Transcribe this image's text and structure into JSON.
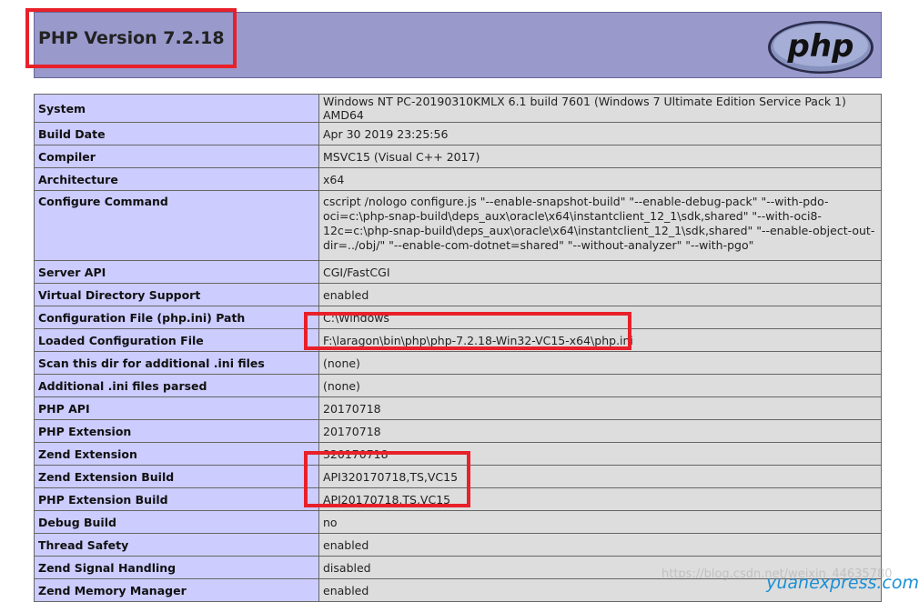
{
  "header": {
    "title": "PHP Version 7.2.18",
    "logo_text": "php"
  },
  "rows": [
    {
      "key": "System",
      "value": "Windows NT PC-20190310KMLX 6.1 build 7601 (Windows 7 Ultimate Edition Service Pack 1) AMD64"
    },
    {
      "key": "Build Date",
      "value": "Apr 30 2019 23:25:56"
    },
    {
      "key": "Compiler",
      "value": "MSVC15 (Visual C++ 2017)"
    },
    {
      "key": "Architecture",
      "value": "x64"
    },
    {
      "key": "Configure Command",
      "value": "cscript /nologo configure.js \"--enable-snapshot-build\" \"--enable-debug-pack\" \"--with-pdo-oci=c:\\php-snap-build\\deps_aux\\oracle\\x64\\instantclient_12_1\\sdk,shared\" \"--with-oci8-12c=c:\\php-snap-build\\deps_aux\\oracle\\x64\\instantclient_12_1\\sdk,shared\" \"--enable-object-out-dir=../obj/\" \"--enable-com-dotnet=shared\" \"--without-analyzer\" \"--with-pgo\""
    },
    {
      "key": "Server API",
      "value": "CGI/FastCGI"
    },
    {
      "key": "Virtual Directory Support",
      "value": "enabled"
    },
    {
      "key": "Configuration File (php.ini) Path",
      "value": "C:\\Windows"
    },
    {
      "key": "Loaded Configuration File",
      "value": "F:\\laragon\\bin\\php\\php-7.2.18-Win32-VC15-x64\\php.ini"
    },
    {
      "key": "Scan this dir for additional .ini files",
      "value": "(none)"
    },
    {
      "key": "Additional .ini files parsed",
      "value": "(none)"
    },
    {
      "key": "PHP API",
      "value": "20170718"
    },
    {
      "key": "PHP Extension",
      "value": "20170718"
    },
    {
      "key": "Zend Extension",
      "value": "320170718"
    },
    {
      "key": "Zend Extension Build",
      "value": "API320170718,TS,VC15"
    },
    {
      "key": "PHP Extension Build",
      "value": "API20170718,TS,VC15"
    },
    {
      "key": "Debug Build",
      "value": "no"
    },
    {
      "key": "Thread Safety",
      "value": "enabled"
    },
    {
      "key": "Zend Signal Handling",
      "value": "disabled"
    },
    {
      "key": "Zend Memory Manager",
      "value": "enabled"
    }
  ],
  "watermark": {
    "url": "https://blog.csdn.net/weixin_44635780",
    "brand": "yuanexpress.com"
  },
  "colors": {
    "header_bg": "#9999cc",
    "key_bg": "#ccccff",
    "value_bg": "#dddddd",
    "highlight": "#e8202a"
  }
}
